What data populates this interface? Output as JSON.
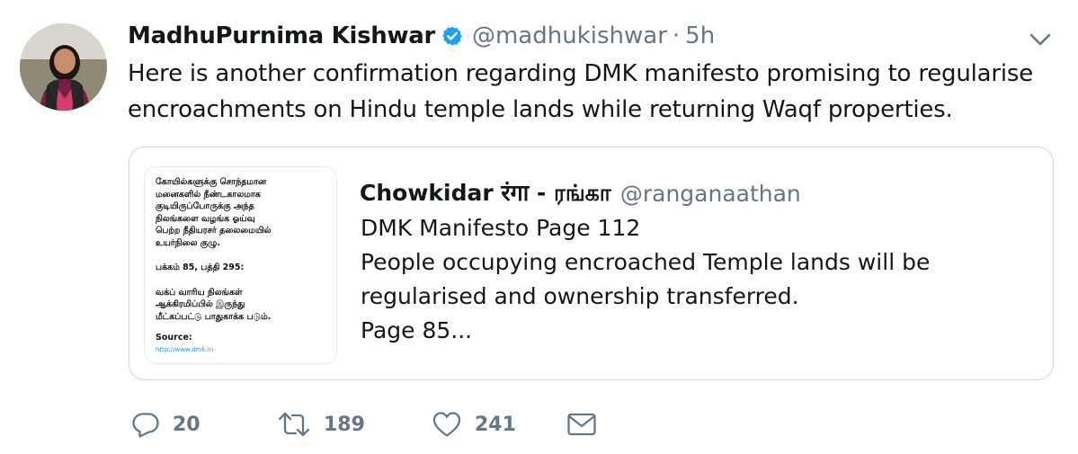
{
  "tweet": {
    "author": {
      "display_name": "MadhuPurnima Kishwar",
      "verified": true,
      "handle": "@madhukishwar",
      "time_separator": "·",
      "time": "5h"
    },
    "text_line1": "Here is another confirmation regarding DMK manifesto promising to regularise",
    "text_line2": "encroachments on Hindu temple lands while returning Waqf properties.",
    "quoted": {
      "display_name": "Chowkidar रंगा - ரங்கா",
      "handle": "@ranganaathan",
      "lines": [
        "DMK Manifesto Page 112",
        "People occupying encroached Temple lands will be",
        "regularised and ownership transferred.",
        "Page 85..."
      ],
      "media": {
        "lines": [
          "கோயில்களுக்கு சொந்தமான",
          "மனைகளில் நீண்டகாலமாக",
          "குடியிருப்போருக்கு அந்த",
          "நிலங்களை வழங்க ஓய்வு",
          "பெற்ற நீதியரசர் தலைமையில்",
          "உயர்நிலை குழு."
        ],
        "page_ref": "பக்கம் 85, பத்தி 295:",
        "lines2": [
          "வக்ப் வாரிய நிலங்கள்",
          "ஆக்கிரமிப்பில் இருந்து",
          "மீட்கப்பட்டு பாதுகாக்க படும்."
        ],
        "source_label": "Source:",
        "source_link": "http://www.dmk.in"
      }
    },
    "actions": {
      "reply_count": "20",
      "retweet_count": "189",
      "like_count": "241"
    }
  },
  "icons": {
    "verified": "verified-badge-icon",
    "chevron": "chevron-down-icon",
    "reply": "reply-icon",
    "retweet": "retweet-icon",
    "like": "heart-icon",
    "dm": "envelope-icon"
  },
  "colors": {
    "text": "#14171a",
    "secondary": "#657786",
    "verified": "#1da1f2",
    "border": "#ccd6dd"
  }
}
